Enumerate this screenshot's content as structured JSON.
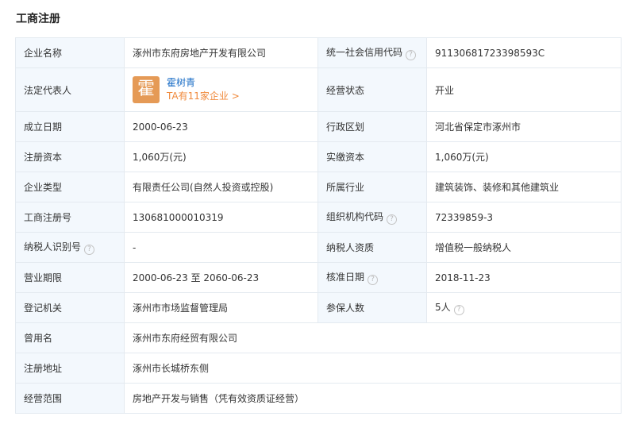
{
  "section": {
    "title": "工商注册"
  },
  "colors": {
    "label_bg": "#f3f8fd",
    "border": "#e4eaf0",
    "link_blue": "#1a6dc6",
    "link_orange": "#f08a3c",
    "avatar_bg": "#e59a56"
  },
  "rows": {
    "company_name": {
      "label": "企业名称",
      "value": "涿州市东府房地产开发有限公司"
    },
    "credit_code": {
      "label": "统一社会信用代码",
      "value": "91130681723398593C"
    },
    "legal_rep": {
      "label": "法定代表人",
      "avatar_char": "霍",
      "name": "霍树青",
      "link": "TA有11家企业 >"
    },
    "status": {
      "label": "经营状态",
      "value": "开业"
    },
    "founded": {
      "label": "成立日期",
      "value": "2000-06-23"
    },
    "region": {
      "label": "行政区划",
      "value": "河北省保定市涿州市"
    },
    "reg_capital": {
      "label": "注册资本",
      "value": "1,060万(元)"
    },
    "paid_capital": {
      "label": "实缴资本",
      "value": "1,060万(元)"
    },
    "company_type": {
      "label": "企业类型",
      "value": "有限责任公司(自然人投资或控股)"
    },
    "industry": {
      "label": "所属行业",
      "value": "建筑装饰、装修和其他建筑业"
    },
    "reg_no": {
      "label": "工商注册号",
      "value": "130681000010319"
    },
    "org_code": {
      "label": "组织机构代码",
      "value": "72339859-3"
    },
    "tax_id": {
      "label": "纳税人识别号",
      "value": "-"
    },
    "tax_qual": {
      "label": "纳税人资质",
      "value": "增值税一般纳税人"
    },
    "term": {
      "label": "营业期限",
      "value": "2000-06-23 至 2060-06-23"
    },
    "approval_date": {
      "label": "核准日期",
      "value": "2018-11-23"
    },
    "authority": {
      "label": "登记机关",
      "value": "涿州市市场监督管理局"
    },
    "insured": {
      "label": "参保人数",
      "value": "5人"
    },
    "former_name": {
      "label": "曾用名",
      "value": "涿州市东府经贸有限公司"
    },
    "address": {
      "label": "注册地址",
      "value": "涿州市长城桥东侧"
    },
    "scope": {
      "label": "经营范围",
      "value": "房地产开发与销售（凭有效资质证经营）"
    }
  },
  "icons": {
    "help": "?"
  }
}
